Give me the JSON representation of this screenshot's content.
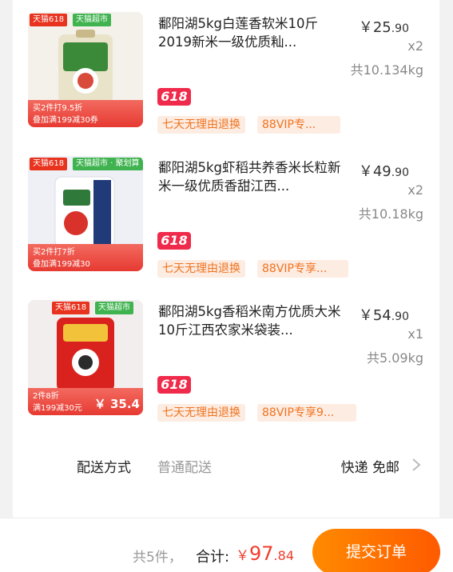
{
  "items": [
    {
      "thumb": {
        "tag_tmall": "天猫618",
        "tag_super": "天猫超市",
        "promo_line1": "买2件打9.5折",
        "promo_line2": "叠加满199减30券"
      },
      "title": "鄱阳湖5kg白莲香软米10斤2019新米一级优质籼...",
      "price_main": "￥25",
      "price_cents": ".90",
      "qty": "x2",
      "weight": "共10.134kg",
      "badge": "618",
      "pill_return": "七天无理由退换",
      "pill_vip": "88VIP专..."
    },
    {
      "thumb": {
        "tag_tmall": "天猫618",
        "tag_super": "天猫超市 · 聚划算",
        "promo_line1": "买2件打7折",
        "promo_line2": "叠加满199减30"
      },
      "title": "鄱阳湖5kg虾稻共养香米长粒新米一级优质香甜江西...",
      "price_main": "￥49",
      "price_cents": ".90",
      "qty": "x2",
      "weight": "共10.18kg",
      "badge": "618",
      "pill_return": "七天无理由退换",
      "pill_vip": "88VIP专享..."
    },
    {
      "thumb": {
        "tag_tmall": "天猫618",
        "tag_super": "天猫超市",
        "promo_line1": "2件8折",
        "promo_line2": "满199减30元",
        "price_tag": "￥ 35.4"
      },
      "title": "鄱阳湖5kg香稻米南方优质大米10斤江西农家米袋装...",
      "price_main": "￥54",
      "price_cents": ".90",
      "qty": "x1",
      "weight": "共5.09kg",
      "badge": "618",
      "pill_return": "七天无理由退换",
      "pill_vip": "88VIP专享9..."
    }
  ],
  "shipping": {
    "label": "配送方式",
    "value": "普通配送",
    "right": "快递 免邮"
  },
  "footer": {
    "count": "共5件，",
    "total_label": "合计:",
    "currency": "￥",
    "total_main": "97",
    "total_cents": ".84",
    "submit": "提交订单"
  },
  "colors": {
    "accent": "#ff6a00",
    "price_red": "#f03c2c",
    "badge_red": "#ef2a4a",
    "pill_bg": "#fdece2",
    "pill_text": "#f0731f"
  }
}
